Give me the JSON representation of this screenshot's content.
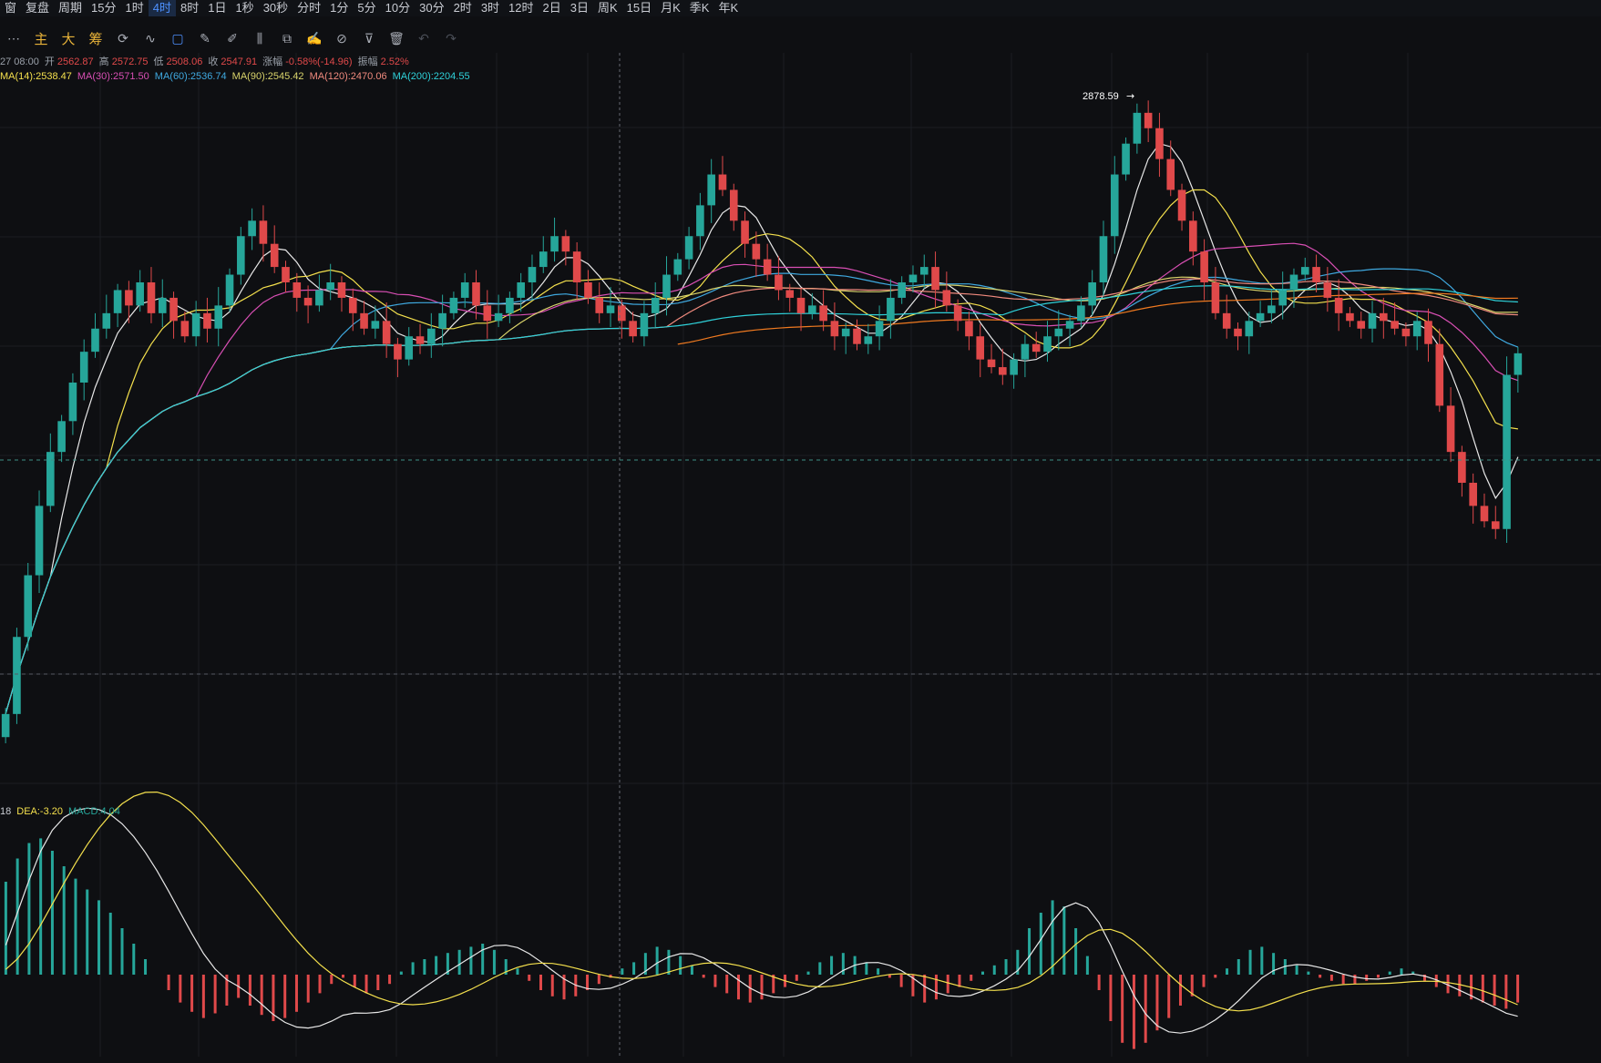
{
  "toolbar_top": {
    "items": [
      "窗",
      "复盘",
      "周期",
      "15分",
      "1时",
      "4时",
      "8时",
      "1日",
      "1秒",
      "30秒",
      "分时",
      "1分",
      "5分",
      "10分",
      "30分",
      "2时",
      "3时",
      "12时",
      "2日",
      "3日",
      "周K",
      "15日",
      "月K",
      "季K",
      "年K"
    ],
    "active": "4时"
  },
  "toolbar_tools": {
    "more": "⋯",
    "main": "主",
    "big": "大",
    "chip": "筹"
  },
  "info": {
    "datetime": "27 08:00",
    "open_label": "开",
    "open": "2562.87",
    "high_label": "高",
    "high": "2572.75",
    "low_label": "低",
    "low": "2508.06",
    "close_label": "收",
    "close": "2547.91",
    "change_label": "涨幅",
    "change": "-0.58%(-14.96)",
    "amp_label": "振幅",
    "amp": "2.52%"
  },
  "ma_legend": [
    {
      "text": "MA(14):2538.47",
      "color": "#f4e04d"
    },
    {
      "text": "MA(30):2571.50",
      "color": "#d94fb4"
    },
    {
      "text": "MA(60):2536.74",
      "color": "#3fa9e0"
    },
    {
      "text": "MA(90):2545.42",
      "color": "#d9d36b"
    },
    {
      "text": "MA(120):2470.06",
      "color": "#f08a7e"
    },
    {
      "text": "MA(200):2204.55",
      "color": "#2fd1d9"
    }
  ],
  "macd_legend": [
    {
      "text": "18",
      "color": "#c9ccd3"
    },
    {
      "text": "DEA:-3.20",
      "color": "#f4e04d"
    },
    {
      "text": "MACD:4.04",
      "color": "#26a69a"
    }
  ],
  "chart_data": {
    "type": "candlestick",
    "high_marker": "2878.59",
    "price_range": [
      1990,
      2900
    ],
    "up_color": "#26a69a",
    "down_color": "#e0494a",
    "ma_colors": {
      "white": "#e8e8e8",
      "ma14": "#f4e04d",
      "ma30": "#d94fb4",
      "ma60": "#3fa9e0",
      "ma90": "#d9d36b",
      "ma120": "#f08a7e",
      "ma200": "#2fd1d9",
      "long": "#f07a20"
    },
    "closes": [
      2080,
      2180,
      2260,
      2350,
      2420,
      2460,
      2510,
      2550,
      2580,
      2600,
      2630,
      2610,
      2640,
      2600,
      2620,
      2590,
      2570,
      2600,
      2580,
      2610,
      2650,
      2700,
      2720,
      2690,
      2660,
      2640,
      2620,
      2610,
      2630,
      2640,
      2620,
      2600,
      2580,
      2590,
      2560,
      2540,
      2570,
      2560,
      2580,
      2600,
      2620,
      2640,
      2610,
      2590,
      2600,
      2620,
      2640,
      2660,
      2680,
      2700,
      2680,
      2640,
      2620,
      2600,
      2610,
      2590,
      2570,
      2600,
      2620,
      2650,
      2670,
      2700,
      2740,
      2780,
      2760,
      2720,
      2690,
      2670,
      2650,
      2630,
      2620,
      2600,
      2610,
      2590,
      2570,
      2580,
      2560,
      2570,
      2590,
      2620,
      2640,
      2650,
      2660,
      2630,
      2610,
      2590,
      2570,
      2540,
      2530,
      2520,
      2540,
      2560,
      2550,
      2570,
      2580,
      2590,
      2610,
      2640,
      2700,
      2780,
      2820,
      2860,
      2840,
      2800,
      2760,
      2720,
      2680,
      2640,
      2600,
      2580,
      2570,
      2590,
      2600,
      2610,
      2630,
      2650,
      2660,
      2640,
      2620,
      2600,
      2590,
      2580,
      2600,
      2590,
      2580,
      2570,
      2590,
      2560,
      2480,
      2420,
      2380,
      2350,
      2330,
      2320,
      2520,
      2548
    ],
    "macd_hist": [
      60,
      75,
      85,
      88,
      80,
      70,
      62,
      55,
      48,
      40,
      30,
      20,
      10,
      0,
      -10,
      -18,
      -24,
      -28,
      -25,
      -20,
      -15,
      -20,
      -26,
      -30,
      -28,
      -24,
      -18,
      -12,
      -6,
      -2,
      -8,
      -12,
      -10,
      -6,
      2,
      8,
      10,
      12,
      14,
      16,
      18,
      20,
      16,
      10,
      4,
      -4,
      -10,
      -14,
      -16,
      -14,
      -10,
      -6,
      -2,
      4,
      8,
      14,
      18,
      16,
      12,
      6,
      -2,
      -8,
      -12,
      -16,
      -18,
      -16,
      -12,
      -8,
      -4,
      2,
      8,
      12,
      14,
      12,
      8,
      4,
      -2,
      -8,
      -14,
      -18,
      -16,
      -12,
      -8,
      -4,
      2,
      6,
      10,
      16,
      30,
      40,
      48,
      44,
      30,
      12,
      -10,
      -30,
      -44,
      -48,
      -44,
      -36,
      -28,
      -20,
      -14,
      -8,
      -2,
      4,
      10,
      16,
      18,
      14,
      10,
      6,
      2,
      -2,
      -4,
      -6,
      -6,
      -4,
      -2,
      2,
      4,
      2,
      -4,
      -8,
      -12,
      -14,
      -16,
      -18,
      -20,
      -22,
      -18
    ]
  }
}
